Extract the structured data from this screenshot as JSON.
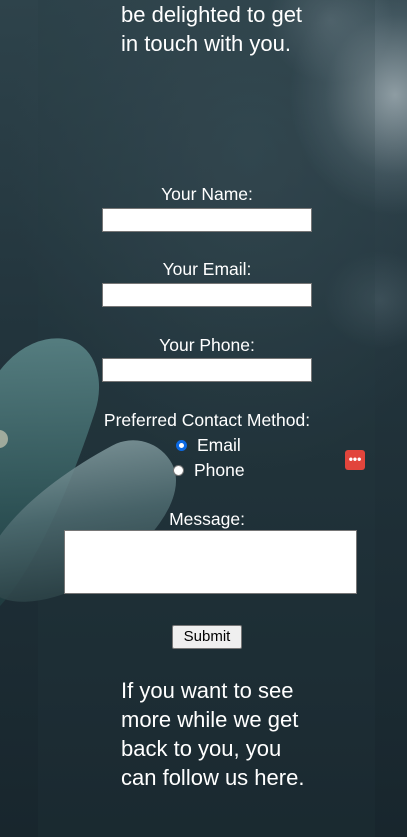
{
  "intro_text": "be delighted to get in touch with you.",
  "form": {
    "name_label": "Your Name:",
    "name_value": "",
    "email_label": "Your Email:",
    "email_value": "",
    "phone_label": "Your Phone:",
    "phone_value": "",
    "contact_method_label": "Preferred Contact Method:",
    "contact_options": [
      {
        "label": "Email",
        "selected": true
      },
      {
        "label": "Phone",
        "selected": false
      }
    ],
    "message_label": "Message:",
    "message_value": "",
    "submit_label": "Submit"
  },
  "outro_text": "If you want to see more while we get back to you, you can follow us here.",
  "floating_button": {
    "icon": "ellipsis-icon",
    "glyph": "•••",
    "color": "#e2453c"
  },
  "colors": {
    "accent": "#0b69e3",
    "text": "#ffffff"
  }
}
